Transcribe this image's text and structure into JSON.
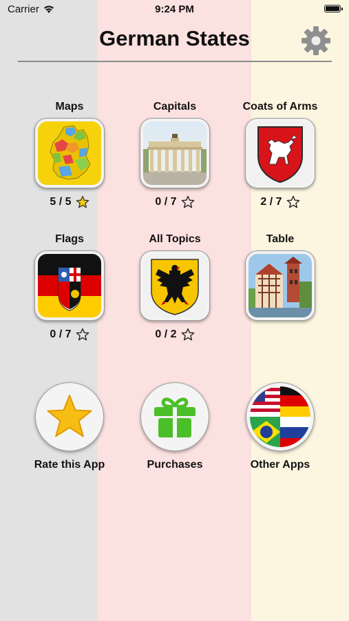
{
  "status_bar": {
    "carrier": "Carrier",
    "time": "9:24 PM"
  },
  "header": {
    "title": "German States",
    "settings_icon": "gear-icon"
  },
  "colors": {
    "left_band": "#e2e2e2",
    "middle_band": "#fbe1df",
    "right_band": "#fcf6e1",
    "star_filled": "#f6c90e"
  },
  "topics": [
    {
      "label": "Maps",
      "score": "5 / 5",
      "star": "filled",
      "icon": "map-icon"
    },
    {
      "label": "Capitals",
      "score": "0 / 7",
      "star": "outline",
      "icon": "brandenburg-gate-icon"
    },
    {
      "label": "Coats of Arms",
      "score": "2 / 7",
      "star": "outline",
      "icon": "coat-of-arms-horse-icon"
    },
    {
      "label": "Flags",
      "score": "0 / 7",
      "star": "outline",
      "icon": "saarland-flag-icon"
    },
    {
      "label": "All Topics",
      "score": "0 / 2",
      "star": "outline",
      "icon": "german-eagle-icon"
    },
    {
      "label": "Table",
      "icon": "town-buildings-icon"
    }
  ],
  "actions": [
    {
      "label": "Rate this App",
      "icon": "star-icon"
    },
    {
      "label": "Purchases",
      "icon": "gift-icon"
    },
    {
      "label": "Other Apps",
      "icon": "world-flags-icon"
    }
  ]
}
